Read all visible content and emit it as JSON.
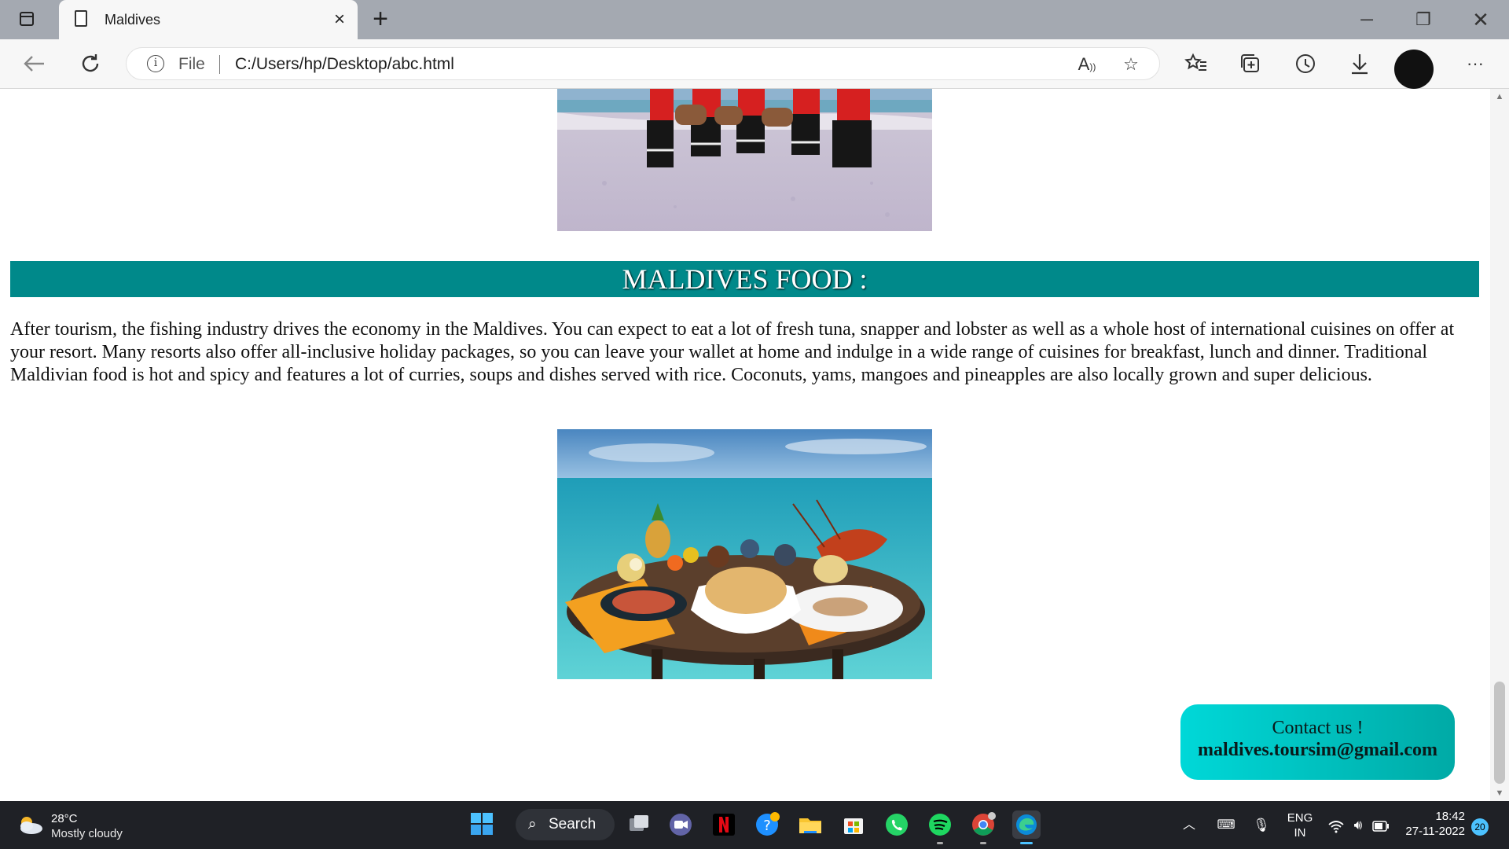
{
  "browser": {
    "tab_title": "Maldives",
    "address_scheme": "File",
    "address_url": "C:/Users/hp/Desktop/abc.html"
  },
  "page": {
    "food_heading": "MALDIVES FOOD :",
    "food_paragraph": "After tourism, the fishing industry drives the economy in the Maldives. You can expect to eat a lot of fresh tuna, snapper and lobster as well as a whole host of international cuisines on offer at your resort. Many resorts also offer all-inclusive holiday packages, so you can leave your wallet at home and indulge in a wide range of cuisines for breakfast, lunch and dinner. Traditional Maldivian food is hot and spicy and features a lot of curries, soups and dishes served with rice. Coconuts, yams, mangoes and pineapples are also locally grown and super delicious.",
    "contact_line1": "Contact us !",
    "contact_email": "maldives.toursim@gmail.com",
    "heading_color": "#00898a",
    "contact_color": "#00d0d0"
  },
  "taskbar": {
    "temperature": "28°C",
    "weather": "Mostly cloudy",
    "search_label": "Search",
    "lang_top": "ENG",
    "lang_bottom": "IN",
    "time": "18:42",
    "date": "27-11-2022",
    "notification_count": "20"
  },
  "icons": [
    "tab-actions-icon",
    "page-icon",
    "close-icon",
    "plus-icon",
    "minimize-icon",
    "restore-icon",
    "back-icon",
    "refresh-icon",
    "info-icon",
    "read-aloud-icon",
    "add-favorite-icon",
    "favorites-icon",
    "collections-icon",
    "history-icon",
    "download-icon",
    "more-icon",
    "windows-start-icon",
    "search-icon",
    "task-view-icon",
    "teams-icon",
    "netflix-icon",
    "edge-icon",
    "chrome-icon",
    "whatsapp-icon",
    "spotify-icon",
    "file-explorer-icon",
    "store-icon",
    "wifi-icon",
    "volume-icon",
    "battery-icon",
    "microphone-icon",
    "keyboard-icon"
  ]
}
